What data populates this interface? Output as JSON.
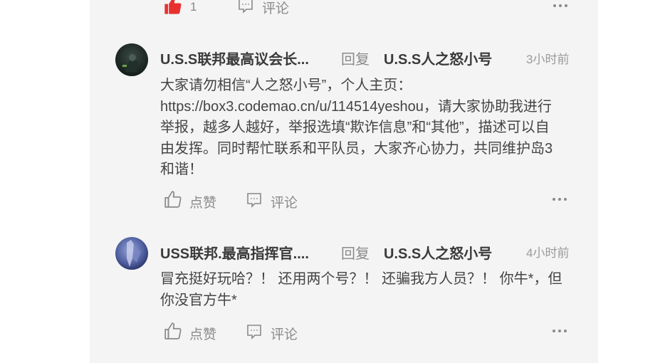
{
  "previous_comment": {
    "like_count": "1",
    "comment_label": "评论"
  },
  "comments": [
    {
      "author": "U.S.S联邦最高议会长...",
      "reply_word": "回复",
      "reply_to": "U.S.S人之怒小号",
      "time": "3小时前",
      "lines": [
        "大家请勿相信“人之怒小号”，个人主页：",
        "https://box3.codemao.cn/u/114514yeshou，请大家协助我进行",
        "举报，越多人越好，举报选填“欺诈信息”和“其他”，描述可以自",
        "由发挥。同时帮忙联系和平队员，大家齐心协力，共同维护岛3",
        "和谐！"
      ],
      "like_label": "点赞",
      "comment_label": "评论"
    },
    {
      "author": "USS联邦.最高指挥官....",
      "reply_word": "回复",
      "reply_to": "U.S.S人之怒小号",
      "time": "4小时前",
      "lines": [
        "冒充挺好玩哈？！ 还用两个号？！ 还骗我方人员？！ 你牛*，但",
        "你没官方牛*"
      ],
      "like_label": "点赞",
      "comment_label": "评论"
    }
  ],
  "icons": {
    "like": "thumbs-up-icon",
    "liked": "thumbs-up-filled-icon",
    "comment": "comment-bubble-icon",
    "more": "more-dots-icon"
  },
  "colors": {
    "panel_bg": "#f4f4f4",
    "liked_red": "#e8312f",
    "icon_gray": "#8a8a8a"
  }
}
